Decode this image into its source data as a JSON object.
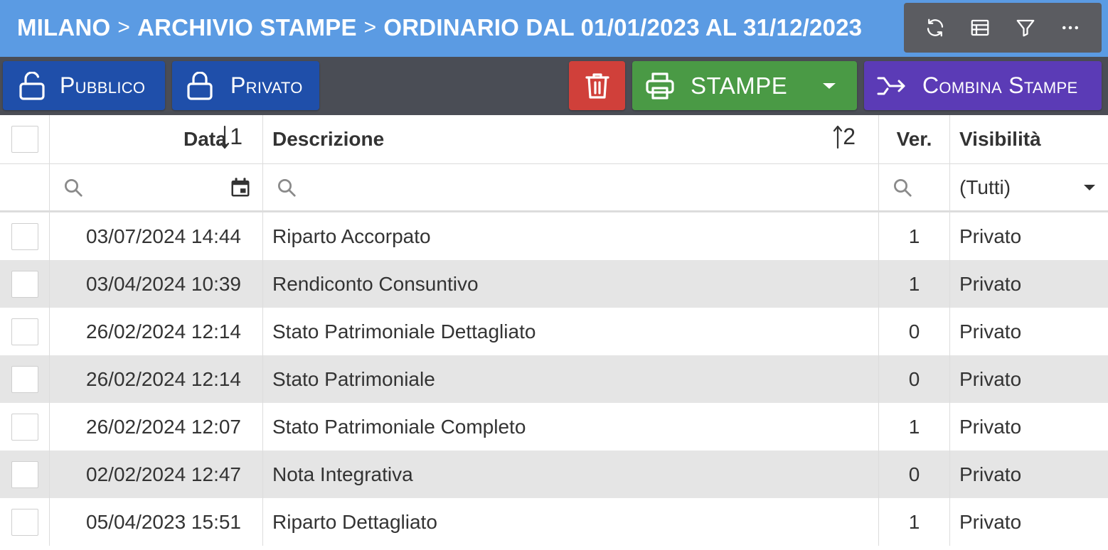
{
  "header": {
    "breadcrumb": [
      "MILANO",
      "ARCHIVIO STAMPE",
      "ORDINARIO DAL 01/01/2023 AL 31/12/2023"
    ],
    "separator": ">",
    "tools": [
      "refresh-icon",
      "table-icon",
      "filter-icon",
      "more-icon"
    ]
  },
  "toolbar": {
    "pubblico_label": "Pubblico",
    "privato_label": "Privato",
    "stampe_label": "STAMPE",
    "combina_label": "Combina Stampe",
    "colors": {
      "pubblico": "#1f4faa",
      "delete": "#d0403a",
      "stampe": "#4a9a45",
      "combina": "#5b3bb6"
    }
  },
  "grid": {
    "columns": [
      {
        "label": "Data",
        "sort": "1"
      },
      {
        "label": "Descrizione",
        "sort": "2"
      },
      {
        "label": "Ver."
      },
      {
        "label": "Visibilità"
      }
    ],
    "filter": {
      "visibility_value": "(Tutti)"
    },
    "rows": [
      {
        "date": "03/07/2024 14:44",
        "desc": "Riparto Accorpato",
        "ver": "1",
        "vis": "Privato"
      },
      {
        "date": "03/04/2024 10:39",
        "desc": "Rendiconto Consuntivo",
        "ver": "1",
        "vis": "Privato"
      },
      {
        "date": "26/02/2024 12:14",
        "desc": "Stato Patrimoniale Dettagliato",
        "ver": "0",
        "vis": "Privato"
      },
      {
        "date": "26/02/2024 12:14",
        "desc": "Stato Patrimoniale",
        "ver": "0",
        "vis": "Privato"
      },
      {
        "date": "26/02/2024 12:07",
        "desc": "Stato Patrimoniale Completo",
        "ver": "1",
        "vis": "Privato"
      },
      {
        "date": "02/02/2024 12:47",
        "desc": "Nota Integrativa",
        "ver": "0",
        "vis": "Privato"
      },
      {
        "date": "05/04/2023 15:51",
        "desc": "Riparto Dettagliato",
        "ver": "1",
        "vis": "Privato"
      }
    ]
  }
}
